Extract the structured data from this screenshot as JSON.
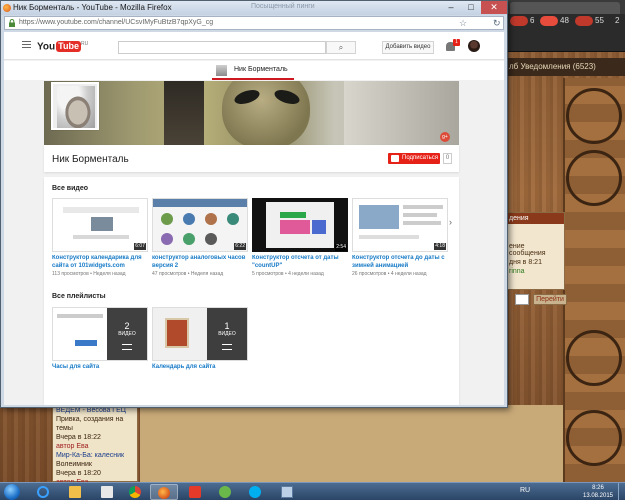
{
  "window": {
    "title": "Ник Борменталь - YouTube - Mozilla Firefox",
    "url": "https://www.youtube.com/channel/UCsvIMyFuBtzB7qpXyG_cg",
    "minimize_glyph": "–",
    "maximize_glyph": "□",
    "close_glyph": "✕",
    "star_glyph": "☆",
    "refresh_glyph": "↻",
    "ghost_tab": "Посыщенный пинги"
  },
  "youtube": {
    "logo_you": "You",
    "logo_tube": "Tube",
    "logo_region": "RU",
    "search_placeholder": "",
    "search_icon": "⌕",
    "upload_label": "Добавить видео",
    "notification_count": "1",
    "channel_tab_name": "Ник Борменталь",
    "channel_title": "Ник Борменталь",
    "subscribe_label": "Подписаться",
    "subscriber_count": "0",
    "gplus_label": "g+",
    "next_arrow": "›",
    "all_videos_title": "Все видео",
    "videos": [
      {
        "title": "Конструктор календарика для сайта от 101widgets.com",
        "meta": "113 просмотров • Неделя назад",
        "duration": "6:07"
      },
      {
        "title": "конструктор аналоговых часов версия 2",
        "meta": "47 просмотров • Неделя назад",
        "duration": "6:22"
      },
      {
        "title": "Конструктор отсчета от даты \"countUP\"",
        "meta": "5 просмотров • 4 недели назад",
        "duration": "2:54"
      },
      {
        "title": "Конструктор отсчета до даты с зимней анимацией",
        "meta": "26 просмотров • 4 недели назад",
        "duration": "4:18"
      }
    ],
    "all_playlists_title": "Все плейлисты",
    "playlists": [
      {
        "title": "Часы для сайта",
        "count": "2",
        "label": "ВИДЕО"
      },
      {
        "title": "Календарь для сайта",
        "count": "1",
        "label": "ВИДЕО"
      }
    ]
  },
  "background_forum": {
    "header_tab": "лб Уведомления (6523)",
    "side_box_header": "дения",
    "side_box_lines": [
      "ение сообщения",
      "дня в 8:21",
      "rinna"
    ],
    "search_button": "Перейти",
    "left_lines": [
      "ВЕДЕМ - Весова ГЕЦ",
      "Привка, создания на",
      "темы",
      "Вчера в 18:22",
      "автор Ева",
      "Мир-Ка-Ба: калесник",
      "Волеимник",
      "Вчера в 18:20",
      "автор Ева"
    ],
    "tray_counts": [
      "6",
      "48",
      "55",
      "2"
    ]
  },
  "taskbar": {
    "language": "RU",
    "time": "8:26",
    "date": "13.08.2015"
  },
  "colors": {
    "youtube_red": "#e62117",
    "link_blue": "#167ac6",
    "firefox_frame": "#cfd9e6",
    "taskbar": "#2a4566"
  },
  "icons": {
    "start": "windows-start-icon",
    "apps": [
      "internet-explorer-icon",
      "explorer-folder-icon",
      "media-player-icon",
      "chrome-icon",
      "firefox-icon",
      "yandex-icon",
      "utorrent-icon",
      "skype-icon",
      "window-icon"
    ]
  }
}
